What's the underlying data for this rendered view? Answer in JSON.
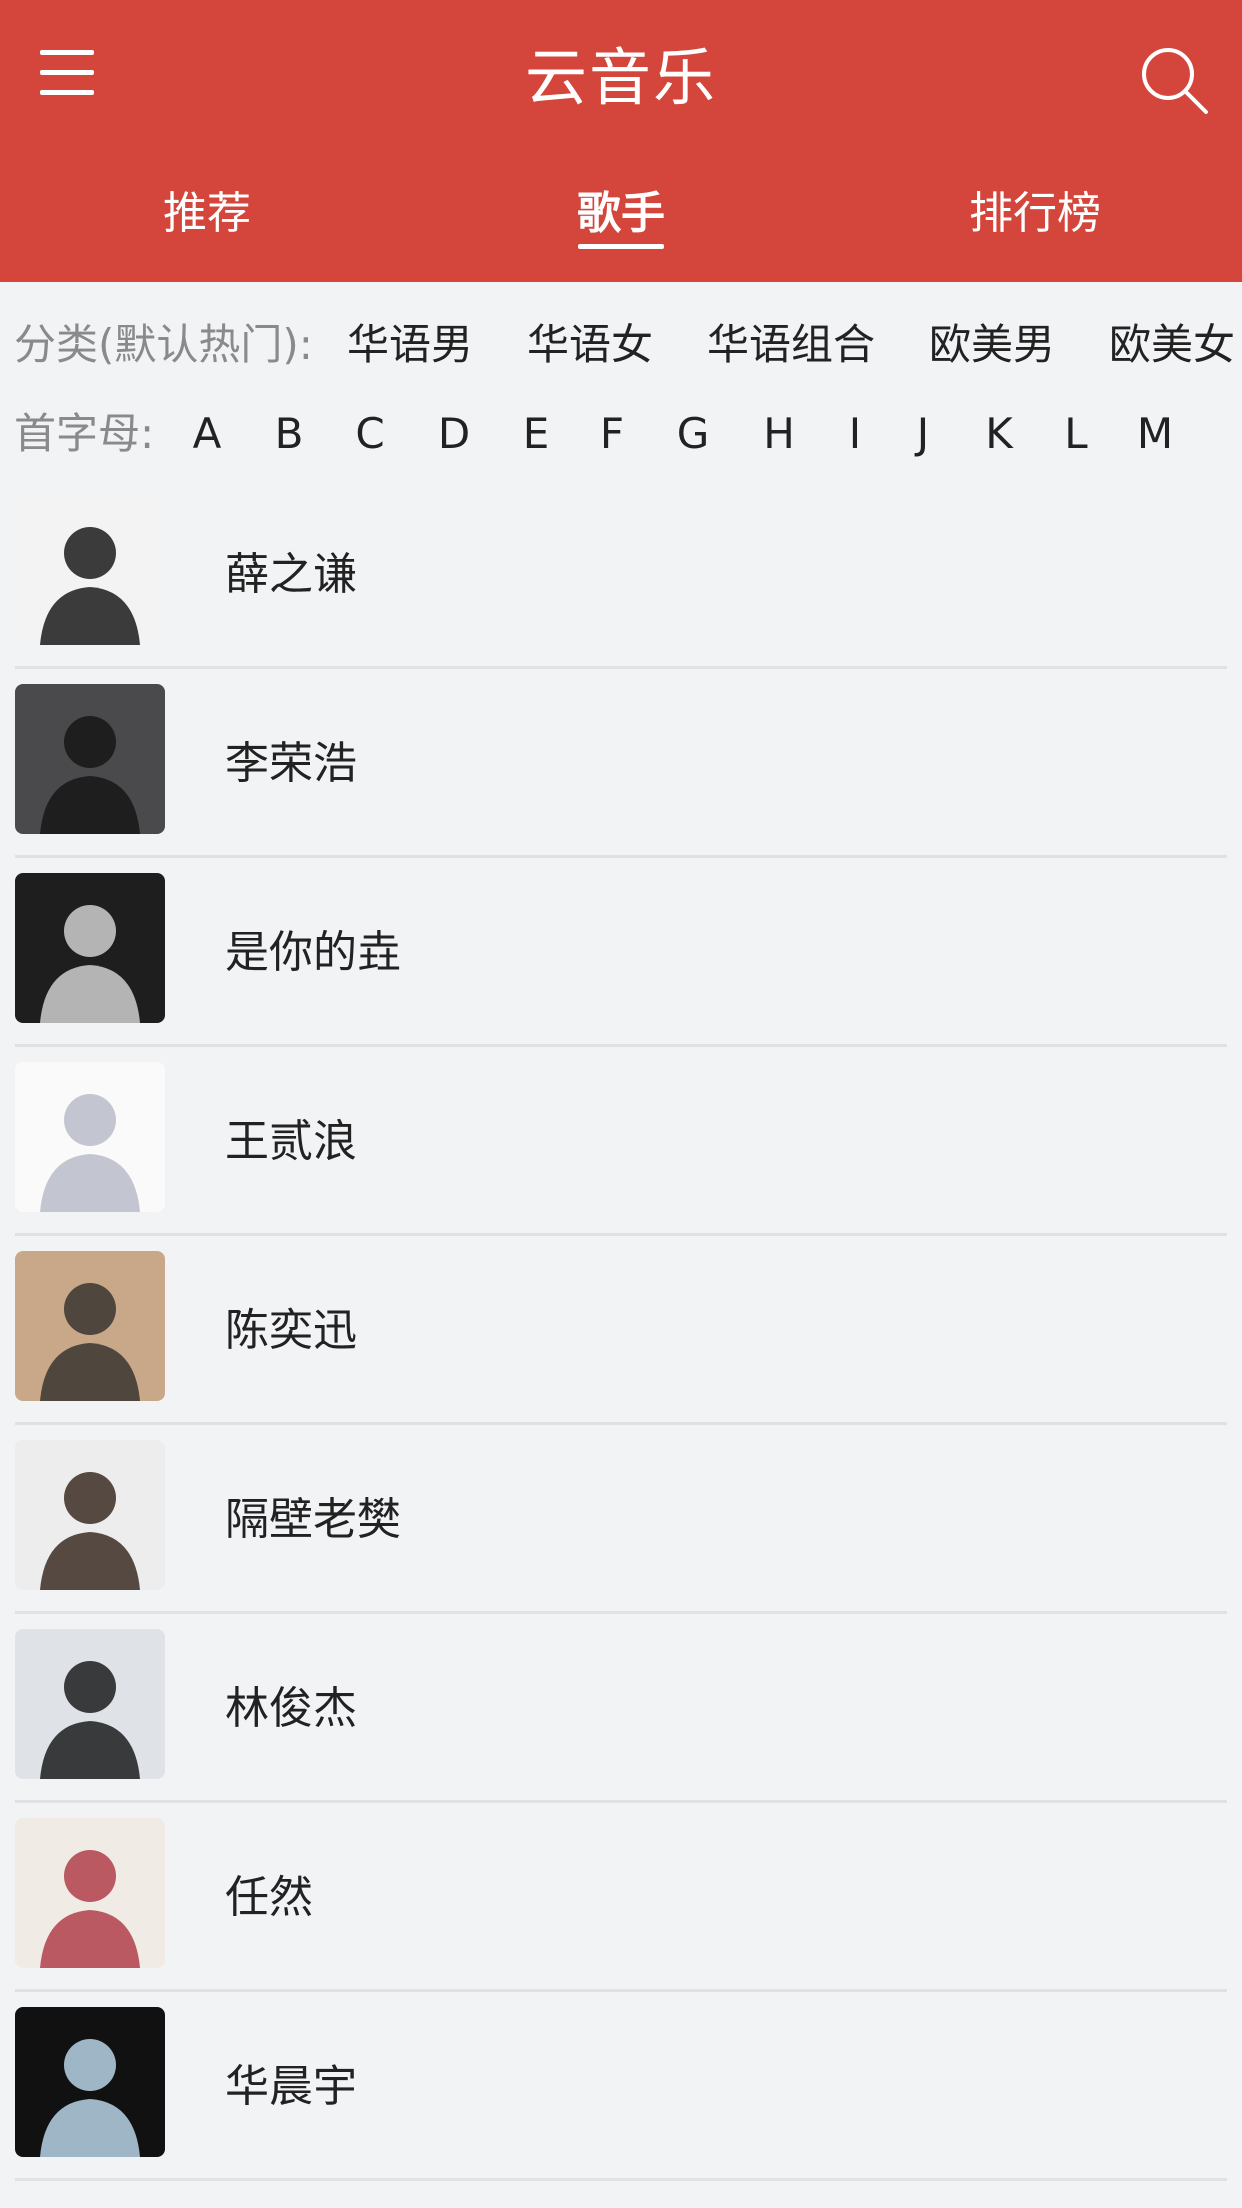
{
  "header": {
    "title": "云音乐",
    "background_color": "#d4453b",
    "menu_icon": "hamburger-menu-icon",
    "search_icon": "search-icon"
  },
  "tabs": [
    {
      "label": "推荐",
      "active": false
    },
    {
      "label": "歌手",
      "active": true
    },
    {
      "label": "排行榜",
      "active": false
    }
  ],
  "category_filter": {
    "label": "分类(默认热门):",
    "options": [
      "华语男",
      "华语女",
      "华语组合",
      "欧美男",
      "欧美女"
    ]
  },
  "initial_filter": {
    "label": "首字母:",
    "letters": [
      "A",
      "B",
      "C",
      "D",
      "E",
      "F",
      "G",
      "H",
      "I",
      "J",
      "K",
      "L",
      "M"
    ]
  },
  "artists": [
    {
      "name": "薛之谦",
      "avatar_bg": "#f3f3f3",
      "avatar_fg": "#1a1a1a"
    },
    {
      "name": "李荣浩",
      "avatar_bg": "#4a4a4c",
      "avatar_fg": "#161616"
    },
    {
      "name": "是你的垚",
      "avatar_bg": "#1e1e1e",
      "avatar_fg": "#cfcfcf"
    },
    {
      "name": "王贰浪",
      "avatar_bg": "#fafafa",
      "avatar_fg": "#b9bcc8"
    },
    {
      "name": "陈奕迅",
      "avatar_bg": "#c9a88a",
      "avatar_fg": "#3a3530"
    },
    {
      "name": "隔壁老樊",
      "avatar_bg": "#ededed",
      "avatar_fg": "#3b2b22"
    },
    {
      "name": "林俊杰",
      "avatar_bg": "#dfe2e7",
      "avatar_fg": "#1c1c1c"
    },
    {
      "name": "任然",
      "avatar_bg": "#f1ebe6",
      "avatar_fg": "#b0404a"
    },
    {
      "name": "华晨宇",
      "avatar_bg": "#111111",
      "avatar_fg": "#b9d3e6"
    }
  ]
}
